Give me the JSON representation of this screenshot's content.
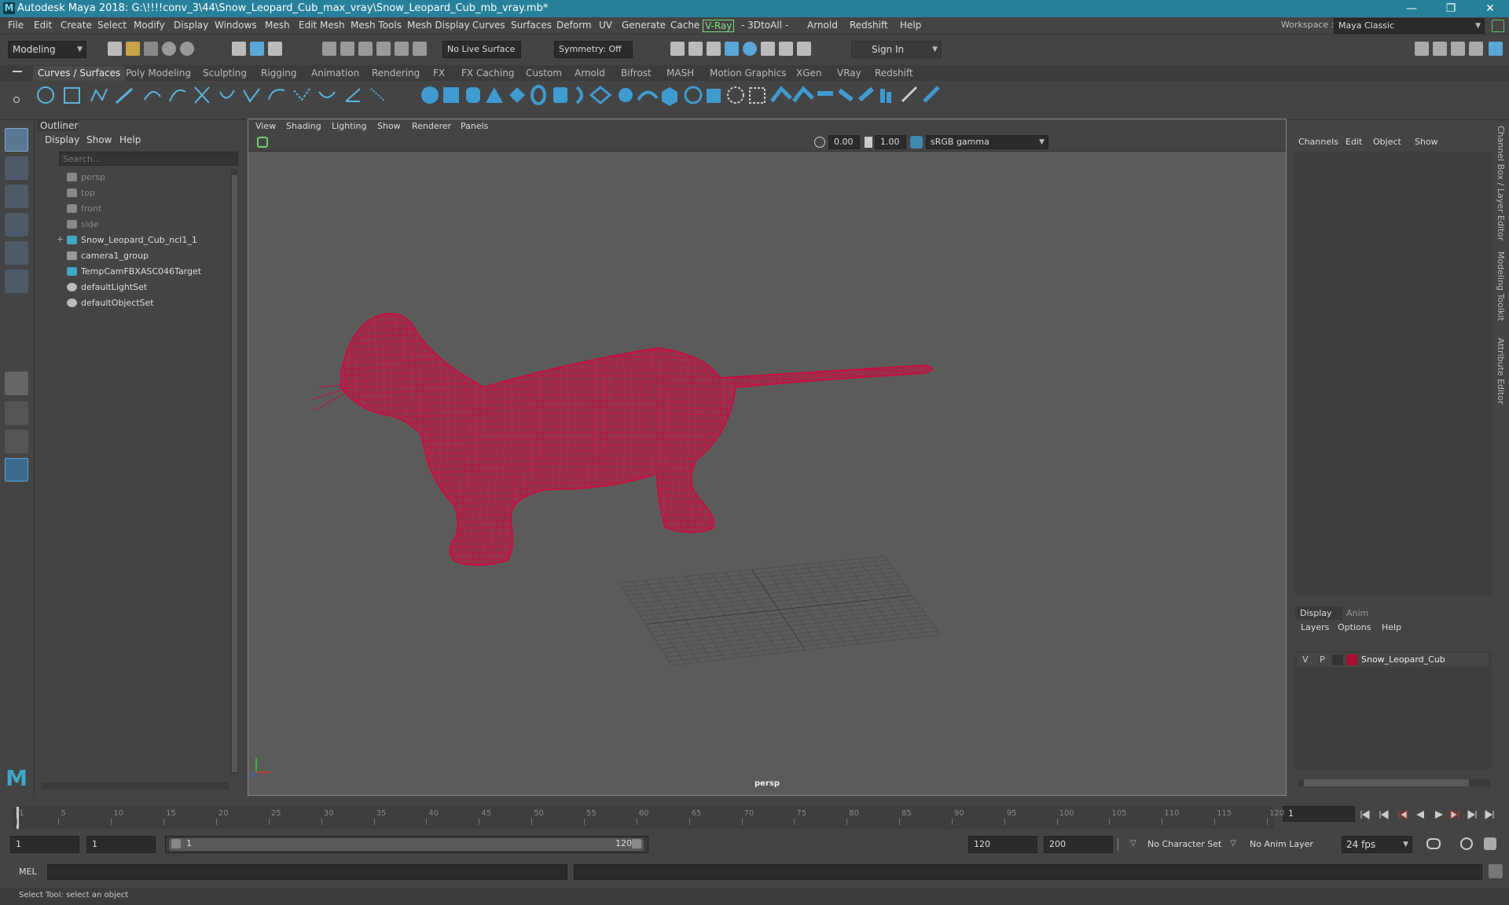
{
  "window": {
    "title": "Autodesk Maya 2018: G:\\!!!!conv_3\\44\\Snow_Leopard_Cub_max_vray\\Snow_Leopard_Cub_mb_vray.mb*",
    "logo": "M",
    "minimize": "—",
    "restore": "❐",
    "close": "✕"
  },
  "menu": [
    "File",
    "Edit",
    "Create",
    "Select",
    "Modify",
    "Display",
    "Windows",
    "Mesh",
    "Edit Mesh",
    "Mesh Tools",
    "Mesh Display",
    "Curves",
    "Surfaces",
    "Deform",
    "UV",
    "Generate",
    "Cache",
    "V-Ray",
    "- 3DtoAll -",
    "Arnold",
    "Redshift",
    "Help"
  ],
  "workspace": {
    "label": "Workspace :",
    "value": "Maya Classic"
  },
  "statusline": {
    "mode": "Modeling",
    "live_surface": "No Live Surface",
    "symmetry": "Symmetry: Off",
    "sign_in": "Sign In"
  },
  "shelf_tabs": [
    "Curves / Surfaces",
    "Poly Modeling",
    "Sculpting",
    "Rigging",
    "Animation",
    "Rendering",
    "FX",
    "FX Caching",
    "Custom",
    "Arnold",
    "Bifrost",
    "MASH",
    "Motion Graphics",
    "XGen",
    "VRay",
    "Redshift"
  ],
  "outliner": {
    "title": "Outliner",
    "menus": [
      "Display",
      "Show",
      "Help"
    ],
    "search_placeholder": "Search...",
    "items": [
      {
        "label": "persp",
        "icon": "camera-icon",
        "dim": true
      },
      {
        "label": "top",
        "icon": "camera-icon",
        "dim": true
      },
      {
        "label": "front",
        "icon": "camera-icon",
        "dim": true
      },
      {
        "label": "side",
        "icon": "camera-icon",
        "dim": true
      },
      {
        "label": "Snow_Leopard_Cub_ncl1_1",
        "icon": "joint-icon",
        "dim": false,
        "expand": "+"
      },
      {
        "label": "camera1_group",
        "icon": "group-icon",
        "dim": false
      },
      {
        "label": "TempCamFBXASC046Target",
        "icon": "joint-icon",
        "dim": false
      },
      {
        "label": "defaultLightSet",
        "icon": "set-icon",
        "dim": false
      },
      {
        "label": "defaultObjectSet",
        "icon": "set-icon",
        "dim": false
      }
    ]
  },
  "viewport": {
    "menus": [
      "View",
      "Shading",
      "Lighting",
      "Show",
      "Renderer",
      "Panels"
    ],
    "near": "0.00",
    "far": "1.00",
    "color_space": "sRGB gamma",
    "camera_label": "persp",
    "mesh_color": "#c3113f"
  },
  "channelbox": {
    "menus": [
      "Channels",
      "Edit",
      "Object",
      "Show"
    ],
    "side_tabs": [
      "Channel Box / Layer Editor",
      "Modeling Toolkit",
      "Attribute Editor"
    ]
  },
  "layers": {
    "tabs": [
      "Display",
      "Anim"
    ],
    "menus": [
      "Layers",
      "Options",
      "Help"
    ],
    "layer": {
      "v": "V",
      "p": "P",
      "name": "Snow_Leopard_Cub",
      "color": "#a8102f"
    }
  },
  "timeline": {
    "ticks": [
      "1",
      "5",
      "10",
      "15",
      "20",
      "25",
      "30",
      "35",
      "40",
      "45",
      "50",
      "55",
      "60",
      "65",
      "70",
      "75",
      "80",
      "85",
      "90",
      "95",
      "100",
      "105",
      "110",
      "115",
      "120"
    ],
    "current_frame": "1"
  },
  "range": {
    "start": "1",
    "playback_start": "1",
    "slider_start": "1",
    "slider_end": "120",
    "playback_end": "120",
    "end": "200",
    "character_set": "No Character Set",
    "anim_layer": "No Anim Layer",
    "fps": "24 fps"
  },
  "cmdline": {
    "label": "MEL"
  },
  "help": "Select Tool: select an object"
}
